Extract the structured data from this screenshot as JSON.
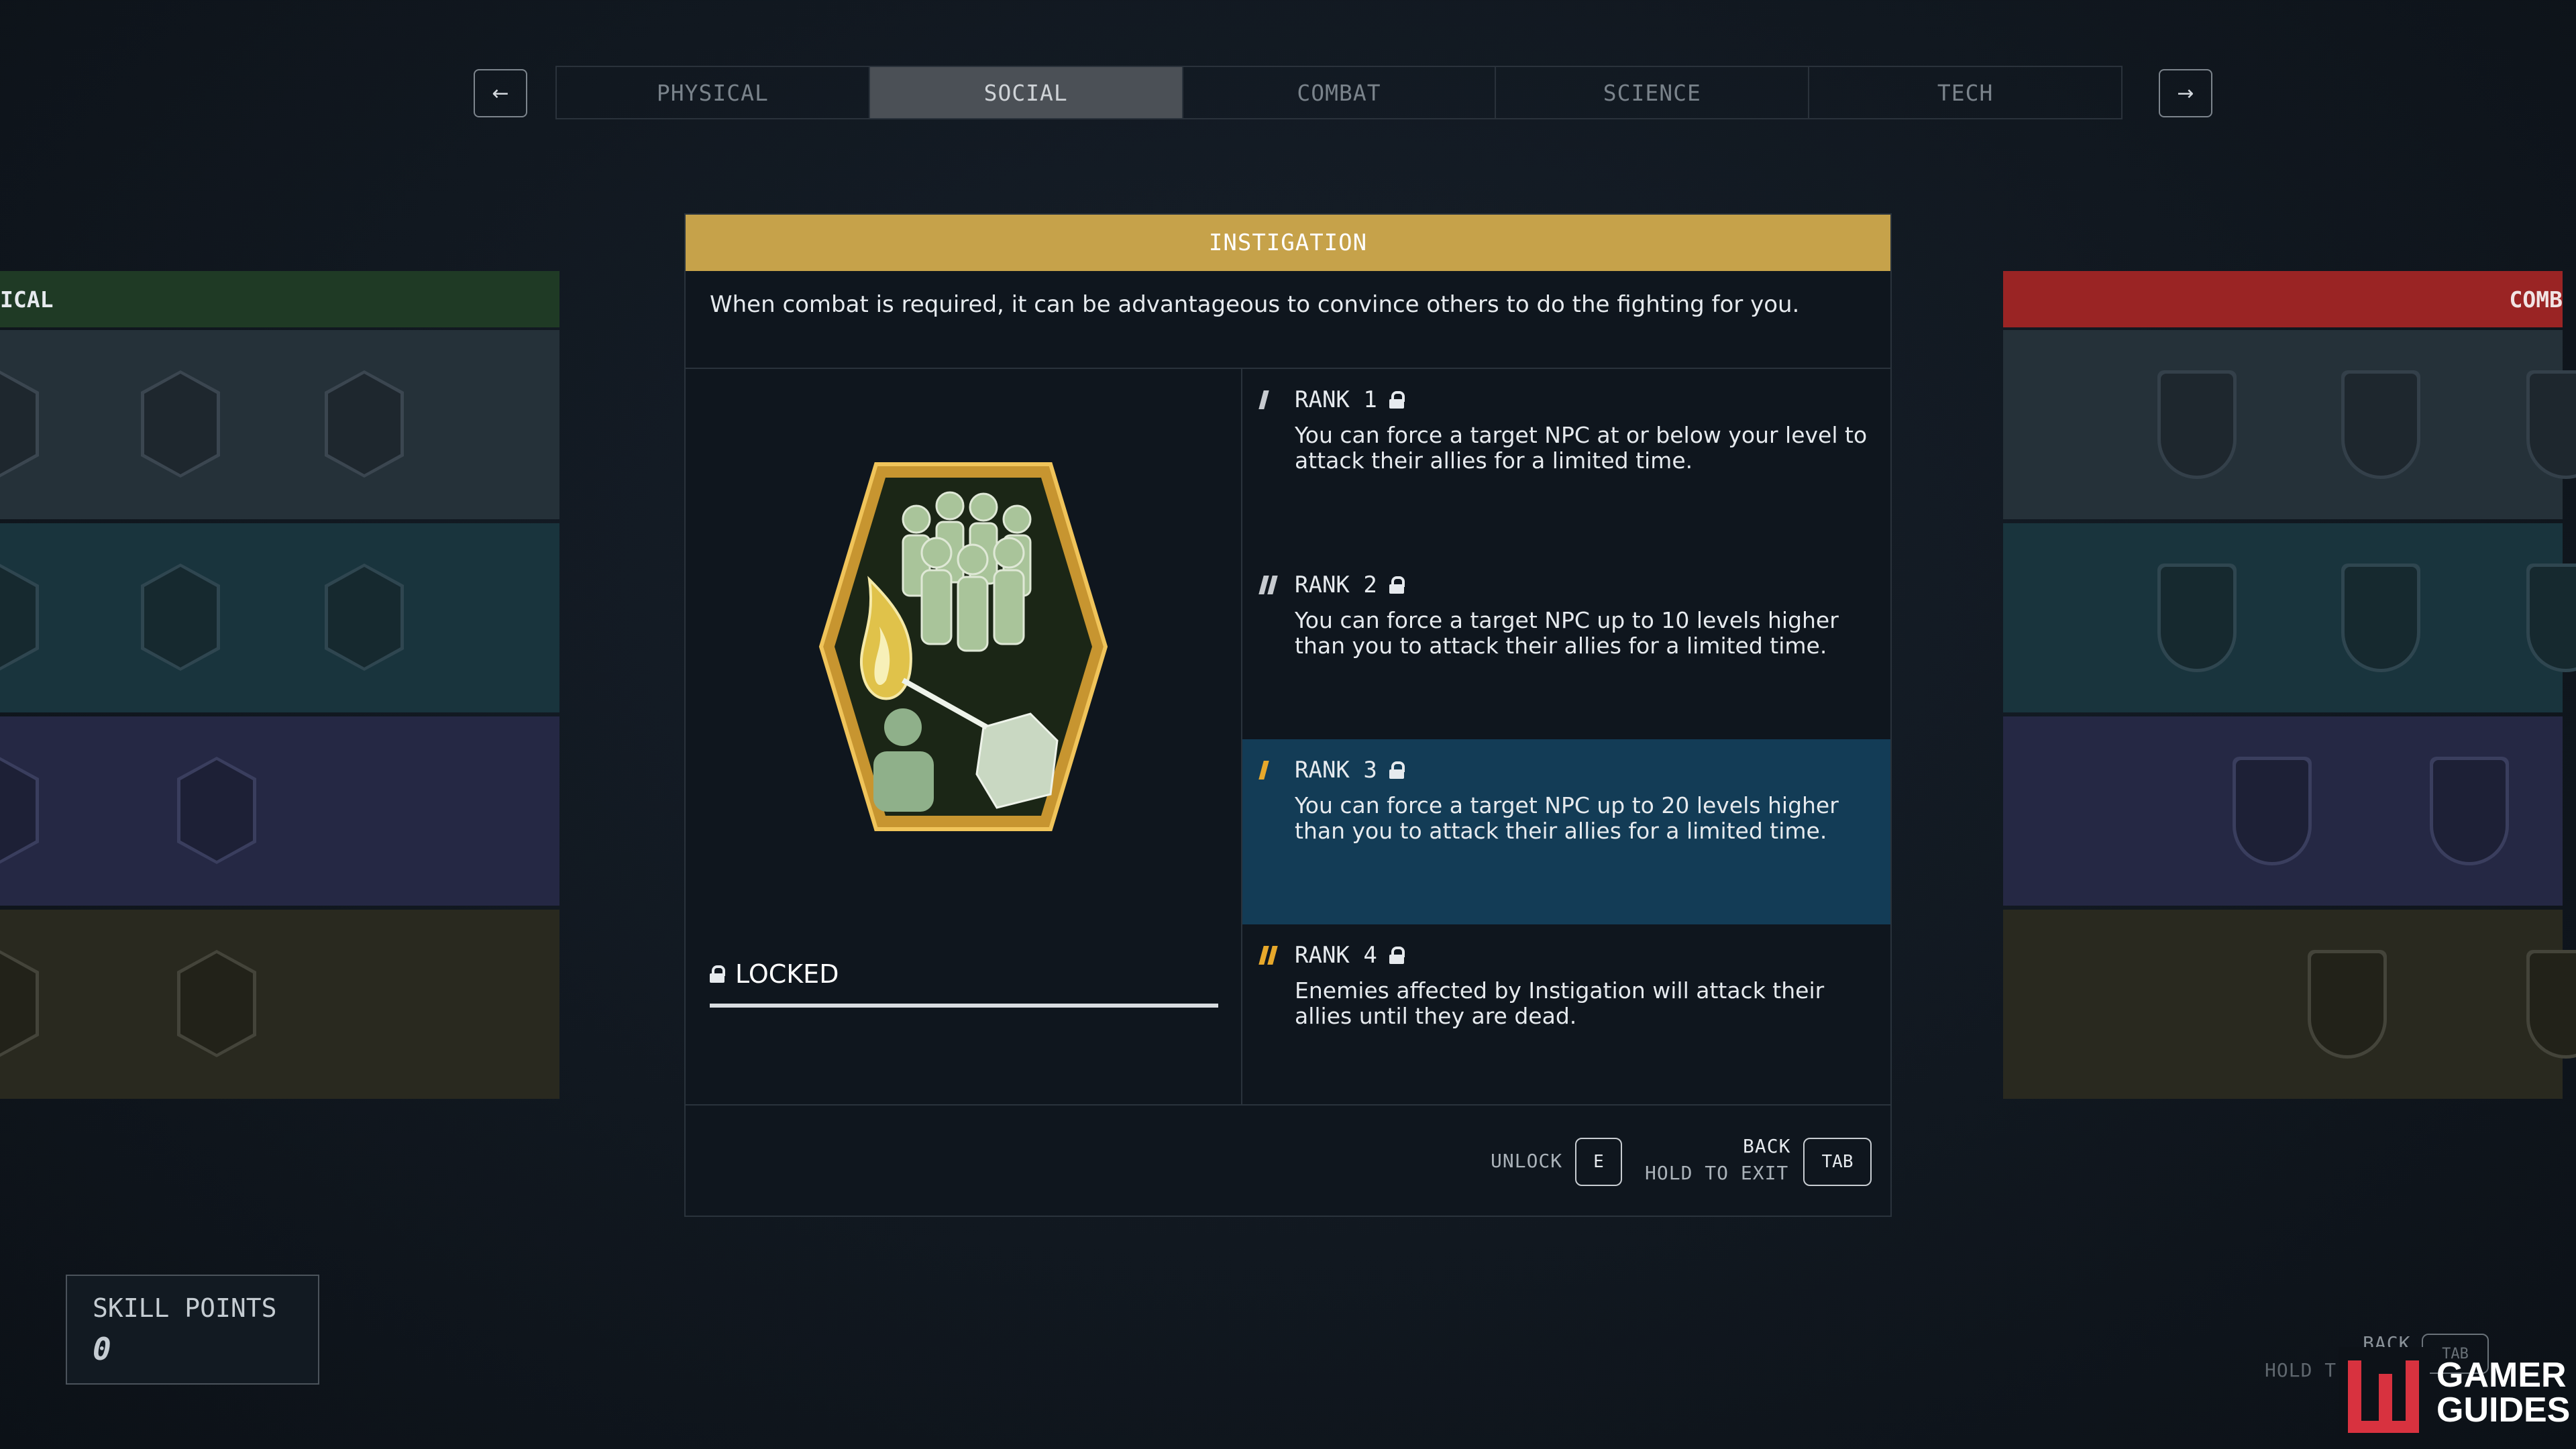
{
  "nav": {
    "prev_icon": "←",
    "next_icon": "→",
    "tabs": [
      "PHYSICAL",
      "SOCIAL",
      "COMBAT",
      "SCIENCE",
      "TECH"
    ],
    "active_tab": "SOCIAL"
  },
  "left_panel": {
    "header": "ICAL",
    "header_color": "#1f3a25"
  },
  "right_panel": {
    "header": "COMB",
    "header_color": "#9a2424"
  },
  "skill": {
    "title": "INSTIGATION",
    "title_color": "#c6a24a",
    "description": "When combat is required, it can be advantageous to convince others to do the fighting for you.",
    "status": "LOCKED",
    "progress": 1.0,
    "ranks": [
      {
        "label": "RANK 1",
        "text": "You can force a target NPC at or below your level to attack their allies for a limited time.",
        "highlight": false
      },
      {
        "label": "RANK 2",
        "text": "You can force a target NPC up to 10 levels higher than you to attack their allies for a limited time.",
        "highlight": false
      },
      {
        "label": "RANK 3",
        "text": "You can force a target NPC up to 20 levels higher than you to attack their allies for a limited time.",
        "highlight": true
      },
      {
        "label": "RANK 4",
        "text": "Enemies affected by Instigation will attack their allies until they are dead.",
        "highlight": false
      }
    ]
  },
  "footer": {
    "unlock_label": "UNLOCK",
    "unlock_key": "E",
    "back_label": "BACK",
    "hold_exit_label": "HOLD TO EXIT",
    "back_key": "TAB"
  },
  "skill_points": {
    "label": "SKILL POINTS",
    "value": "0"
  },
  "corner": {
    "back_label": "BACK",
    "hold_label": "HOLD T",
    "key": "TAB"
  },
  "watermark": {
    "line1": "GAMER",
    "line2": "GUIDES"
  }
}
